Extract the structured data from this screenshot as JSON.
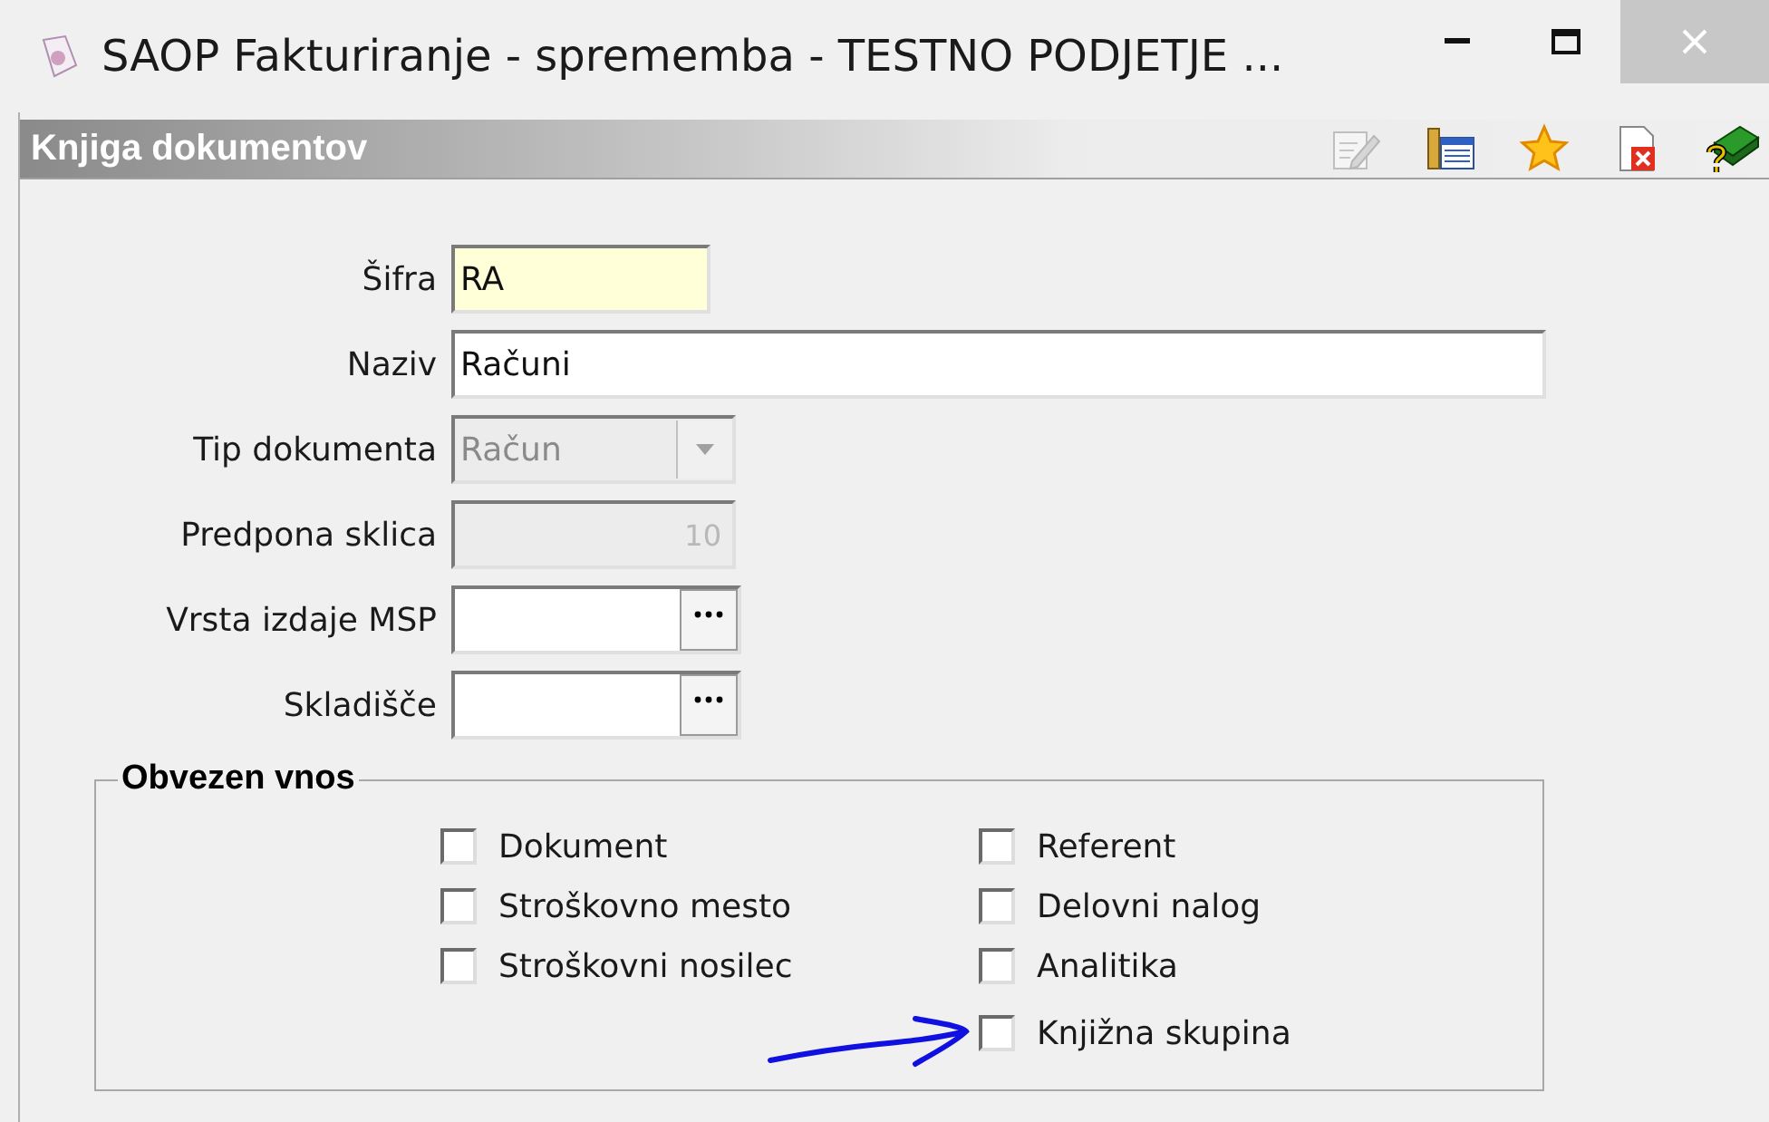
{
  "window": {
    "title": "SAOP Fakturiranje - sprememba - TESTNO PODJETJE ..."
  },
  "header": {
    "title": "Knjiga dokumentov",
    "toolbar": [
      {
        "kind": "edit",
        "disabled": true
      },
      {
        "kind": "columns",
        "disabled": false
      },
      {
        "kind": "favorite",
        "disabled": false
      },
      {
        "kind": "delete",
        "disabled": false
      },
      {
        "kind": "help",
        "disabled": false
      }
    ]
  },
  "fields": [
    {
      "label": "Šifra",
      "kind": "text",
      "value": "RA",
      "highlighted": true,
      "disabled": false
    },
    {
      "label": "Naziv",
      "kind": "wide_text",
      "value": "Računi",
      "highlighted": false,
      "disabled": false
    },
    {
      "label": "Tip dokumenta",
      "kind": "combo",
      "value": "Račun",
      "highlighted": false,
      "disabled": true
    },
    {
      "label": "Predpona sklica",
      "kind": "number",
      "value": "10",
      "highlighted": false,
      "disabled": true
    },
    {
      "label": "Vrsta izdaje MSP",
      "kind": "lookup",
      "highlighted": false,
      "disabled": false
    },
    {
      "label": "Skladišče",
      "kind": "lookup",
      "highlighted": false,
      "disabled": false
    }
  ],
  "required_group": {
    "title": "Obvezen vnos",
    "columns": [
      [
        {
          "label": "Dokument",
          "checked": false
        },
        {
          "label": "Stroškovno mesto",
          "checked": false
        },
        {
          "label": "Stroškovni nosilec",
          "checked": false
        }
      ],
      [
        {
          "label": "Referent",
          "checked": false
        },
        {
          "label": "Delovni nalog",
          "checked": false
        },
        {
          "label": "Analitika",
          "checked": false
        },
        {
          "label": "Knjižna skupina",
          "checked": false
        }
      ]
    ]
  }
}
